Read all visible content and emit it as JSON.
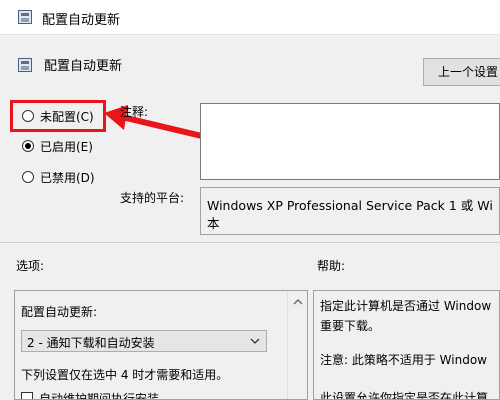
{
  "window": {
    "title": "配置自动更新",
    "icon": "policy-settings-icon"
  },
  "header": {
    "title": "配置自动更新",
    "prev_button": "上一个设置"
  },
  "state": {
    "options": [
      {
        "label": "未配置(C)",
        "selected": false
      },
      {
        "label": "已启用(E)",
        "selected": true
      },
      {
        "label": "已禁用(D)",
        "selected": false
      }
    ]
  },
  "comment": {
    "label": "注释:",
    "value": ""
  },
  "platform": {
    "label": "支持的平台:",
    "value_line1": "Windows XP Professional Service Pack 1 或 Wi",
    "value_line2": "本"
  },
  "options_section": {
    "label": "选项:",
    "configure_label": "配置自动更新:",
    "dropdown_value": "2 - 通知下载和自动安装",
    "note": "下列设置仅在选中 4 时才需要和适用。",
    "checkbox_label": "自动维护期间执行安装"
  },
  "help_section": {
    "label": "帮助:",
    "line1": "指定此计算机是否通过 Window",
    "line2": "重要下载。",
    "line3": "注意: 此策略不适用于 Window",
    "line4": "此设置允许你指定是否在此计算"
  },
  "annotation": {
    "color": "#e8151b"
  }
}
